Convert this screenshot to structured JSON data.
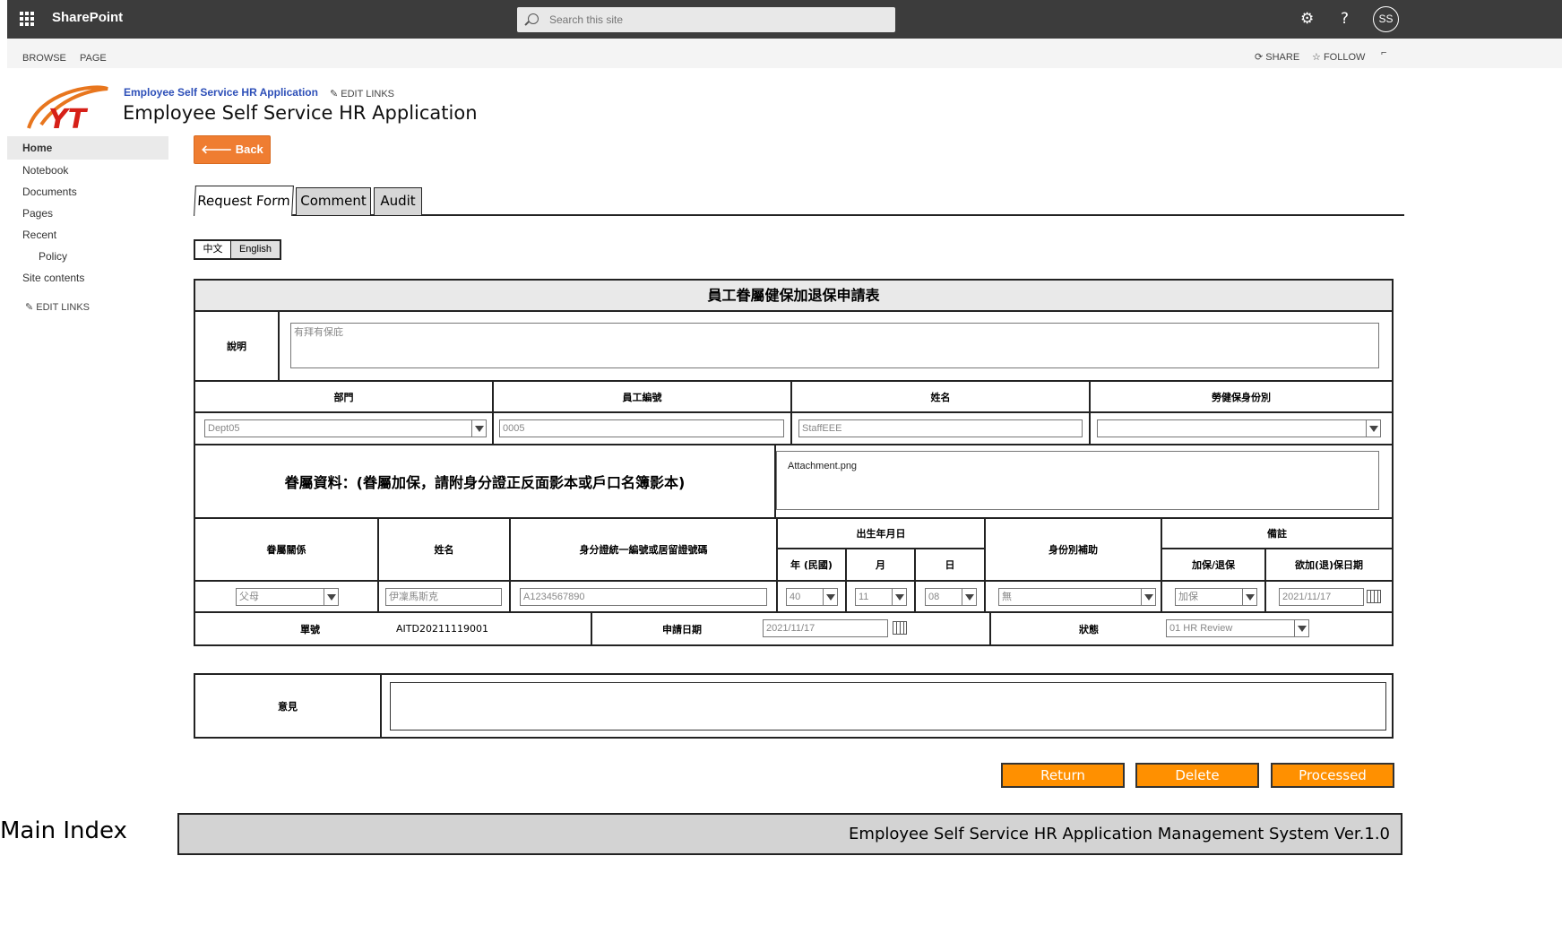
{
  "suite": {
    "brand": "SharePoint",
    "search_placeholder": "Search this site",
    "avatar_initials": "SS"
  },
  "ribbon": {
    "tabs": [
      "BROWSE",
      "PAGE"
    ],
    "share": "SHARE",
    "follow": "FOLLOW"
  },
  "site": {
    "link_title": "Employee Self Service HR Application",
    "edit_links": "EDIT LINKS",
    "title": "Employee Self Service HR Application"
  },
  "nav": {
    "items": [
      "Home",
      "Notebook",
      "Documents",
      "Pages",
      "Recent",
      "Policy",
      "Site contents"
    ],
    "edit_links": "EDIT LINKS"
  },
  "back_label": "Back",
  "tabs": [
    "Request Form",
    "Comment",
    "Audit"
  ],
  "lang": [
    "中文",
    "English"
  ],
  "form": {
    "title": "員工眷屬健保加退保申請表",
    "desc_label": "說明",
    "desc_value": "有拜有保庇",
    "headers1": [
      "部門",
      "員工編號",
      "姓名",
      "勞健保身份別"
    ],
    "dept": "Dept05",
    "emp_no": "0005",
    "name": "StaffEEE",
    "ins_type": "",
    "dependent_heading": "眷屬資料：(眷屬加保，請附身分證正反面影本或戶口名簿影本)",
    "attachment": "Attachment.png",
    "dep_headers": {
      "relation": "眷屬關係",
      "name": "姓名",
      "id": "身分證統一編號或居留證號碼",
      "birth": "出生年月日",
      "year": "年 (民國)",
      "month": "月",
      "day": "日",
      "subsidy": "身份別補助",
      "remark": "備註",
      "add_remove": "加保/退保",
      "date": "欲加(退)保日期"
    },
    "dep_row": {
      "relation": "父母",
      "name": "伊凜馬斯克",
      "id": "A1234567890",
      "year": "40",
      "month": "11",
      "day": "08",
      "subsidy": "無",
      "add_remove": "加保",
      "date": "2021/11/17"
    },
    "footer_row": {
      "no_label": "單號",
      "no_value": "AITD20211119001",
      "apply_label": "申請日期",
      "apply_date": "2021/11/17",
      "status_label": "狀態",
      "status": "01 HR Review"
    }
  },
  "opinion_label": "意見",
  "buttons": [
    "Return",
    "Delete",
    "Processed"
  ],
  "footer": {
    "main_index": "Main Index",
    "system": "Employee Self Service HR Application Management System Ver.1.0"
  },
  "colors": {
    "suitebar": "#3c3c3c",
    "accent_orange": "#ef7d31",
    "action_orange": "#ff9000",
    "site_link": "#2d4fb8"
  }
}
